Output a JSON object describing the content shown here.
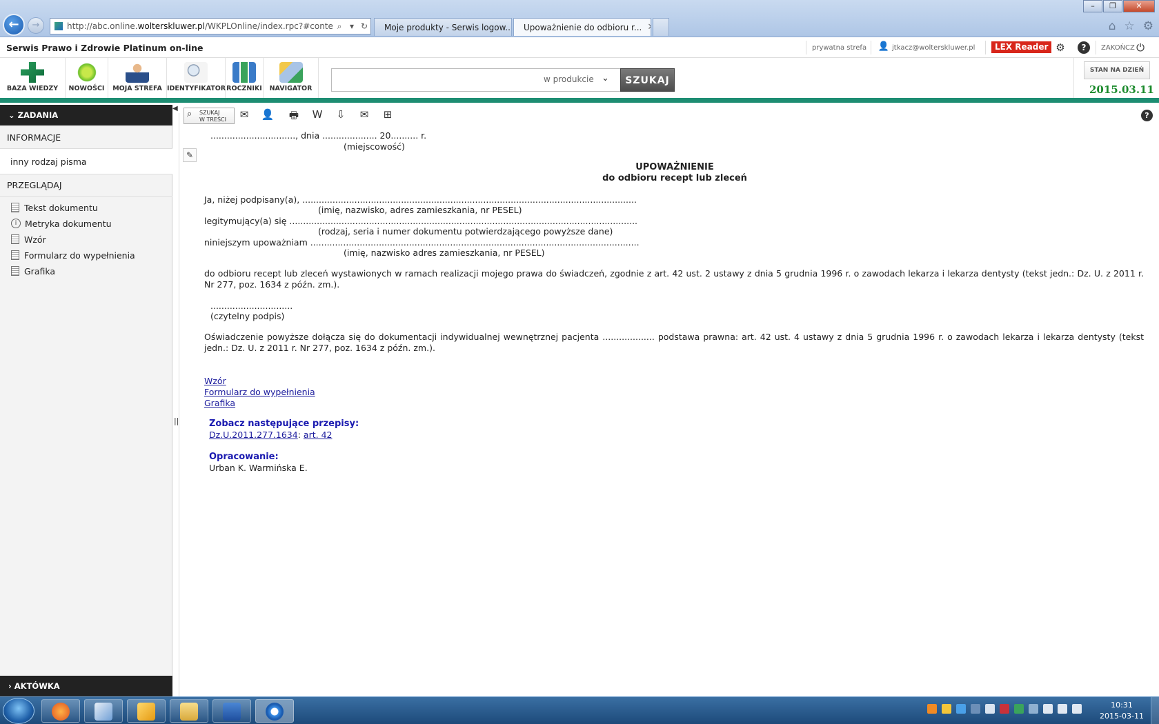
{
  "browser": {
    "url_prefix": "http://abc.online.",
    "url_host": "wolterskluwer.pl",
    "url_path": "/WKPLOnline/index.rpc?#content.rpc--",
    "tabs": [
      {
        "label": "Moje produkty - Serwis logow..."
      },
      {
        "label": "Upoważnienie do odbioru r..."
      }
    ]
  },
  "header": {
    "service_title": "Serwis Prawo i Zdrowie Platinum on-line",
    "private_zone": "prywatna strefa",
    "user_email": "jtkacz@wolterskluwer.pl",
    "lex_reader": "LEX Reader",
    "logout": "ZAKOŃCZ"
  },
  "toolbar": {
    "items": [
      {
        "label": "BAZA WIEDZY"
      },
      {
        "label": "NOWOŚCI"
      },
      {
        "label": "MOJA STREFA"
      },
      {
        "label": "IDENTYFIKATOR"
      },
      {
        "label": "ROCZNIKI"
      },
      {
        "label": "NAVIGATOR"
      }
    ],
    "search_scope": "w produkcie",
    "search_button": "SZUKAJ",
    "stan_label": "STAN NA DZIEŃ",
    "stan_date": "2015.03.11"
  },
  "sidebar": {
    "tasks": "ZADANIA",
    "info_header": "INFORMACJE",
    "info_item": "inny rodzaj pisma",
    "browse_header": "PRZEGLĄDAJ",
    "browse_items": [
      {
        "label": "Tekst dokumentu"
      },
      {
        "label": "Metryka dokumentu"
      },
      {
        "label": "Wzór"
      },
      {
        "label": "Formularz do wypełnienia"
      },
      {
        "label": "Grafika"
      }
    ],
    "briefcase": "AKTÓWKA"
  },
  "doc_toolbar": {
    "search_in_content_1": "SZUKAJ",
    "search_in_content_2": "W TREŚCI"
  },
  "document": {
    "line1": "..............................., dnia .................... 20.......... r.",
    "place_hint": "(miejscowość)",
    "title": "UPOWAŻNIENIE",
    "subtitle": "do odbioru recept lub zleceń",
    "row1": "Ja, niżej podpisany(a), ..........................................................................................................................",
    "row1_hint": "(imię, nazwisko, adres zamieszkania, nr PESEL)",
    "row2": "legitymujący(a) się ...............................................................................................................................",
    "row2_hint": "(rodzaj, seria i numer dokumentu potwierdzającego powyższe dane)",
    "row3": "niniejszym upoważniam ........................................................................................................................",
    "row3_hint": "(imię, nazwisko adres zamieszkania, nr PESEL)",
    "para1": "do odbioru recept lub zleceń wystawionych w ramach realizacji mojego prawa do świadczeń, zgodnie z art. 42 ust. 2 ustawy z dnia 5 grudnia 1996 r. o zawodach lekarza i lekarza dentysty (tekst jedn.: Dz. U. z 2011 r. Nr 277, poz. 1634 z późn. zm.).",
    "sign_dots": "..............................",
    "sign_hint": "(czytelny podpis)",
    "para2": "Oświadczenie powyższe dołącza się do dokumentacji indywidualnej wewnętrznej pacjenta ................... podstawa prawna: art. 42 ust. 4 ustawy z dnia 5 grudnia 1996 r. o zawodach lekarza i lekarza dentysty (tekst jedn.: Dz. U. z 2011 r. Nr 277, poz. 1634 z późn. zm.).",
    "links": [
      {
        "label": "Wzór"
      },
      {
        "label": "Formularz do wypełnienia"
      },
      {
        "label": "Grafika"
      }
    ],
    "see_heading": "Zobacz następujące przepisy:",
    "see_link1": "Dz.U.2011.277.1634",
    "see_sep": ":",
    "see_link2": "art. 42",
    "author_heading": "Opracowanie:",
    "author": "Urban K. Warmińska E."
  },
  "taskbar": {
    "time": "10:31",
    "date": "2015-03-11"
  }
}
